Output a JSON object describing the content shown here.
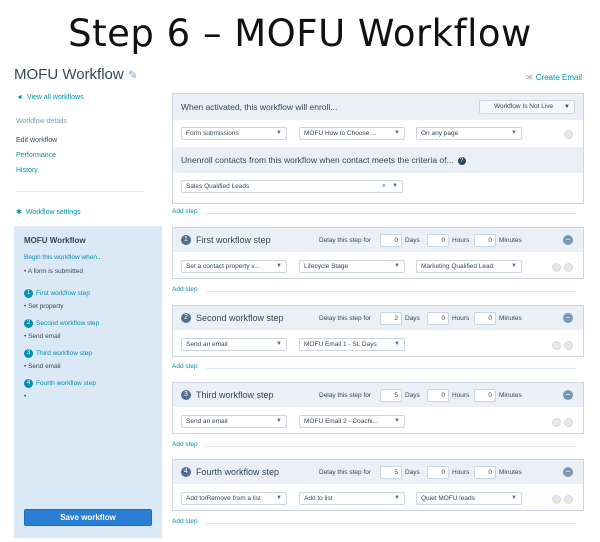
{
  "slide_title": "Step 6 – MOFU Workflow",
  "header": {
    "workflow_title": "MOFU Workflow",
    "create_email": "Create Email"
  },
  "sidebar": {
    "back_link": "View all workflows",
    "details_label": "Workflow details",
    "nav": [
      "Edit workflow",
      "Performance",
      "History"
    ],
    "settings_link": "Workflow settings",
    "summary": {
      "title": "MOFU Workflow",
      "begin_link": "Begin this workflow when...",
      "begin_sub": "• A form is submitted",
      "steps": [
        {
          "num": "1",
          "link": "First workflow step",
          "sub": "• Set property"
        },
        {
          "num": "2",
          "link": "Second workflow step",
          "sub": "• Send email"
        },
        {
          "num": "3",
          "link": "Third workflow step",
          "sub": "• Send email"
        },
        {
          "num": "4",
          "link": "Fourth workflow step",
          "sub": "•"
        }
      ],
      "save_label": "Save workflow"
    }
  },
  "enroll": {
    "heading": "When activated, this workflow will enroll...",
    "status": "Workflow Is Not Live",
    "trigger": [
      "Form submissions",
      "MOFU How to Choose ...",
      "On any page"
    ],
    "unenroll_heading": "Unenroll contacts from this workflow when contact meets the criteria of...",
    "unenroll_value": "Sales Qualified Leads"
  },
  "add_step_label": "Add step",
  "delay_label": "Delay this step for",
  "units": {
    "days": "Days",
    "hours": "Hours",
    "minutes": "Minutes"
  },
  "steps": [
    {
      "num": "1",
      "name": "First workflow step",
      "days": "0",
      "hours": "0",
      "minutes": "0",
      "action": "Set a contact property v...",
      "field": "Lifecycle Stage",
      "value": "Marketing Qualified Lead"
    },
    {
      "num": "2",
      "name": "Second workflow step",
      "days": "2",
      "hours": "0",
      "minutes": "0",
      "action": "Send an email",
      "field": "MOFU Email 1 - SL Days",
      "value": ""
    },
    {
      "num": "3",
      "name": "Third workflow step",
      "days": "5",
      "hours": "0",
      "minutes": "0",
      "action": "Send an email",
      "field": "MOFU Email 2 - Coachi...",
      "value": ""
    },
    {
      "num": "4",
      "name": "Fourth workflow step",
      "days": "5",
      "hours": "0",
      "minutes": "0",
      "action": "Add to/Remove from a list",
      "field": "Add to list",
      "value": "Quiet MOFU leads"
    }
  ]
}
